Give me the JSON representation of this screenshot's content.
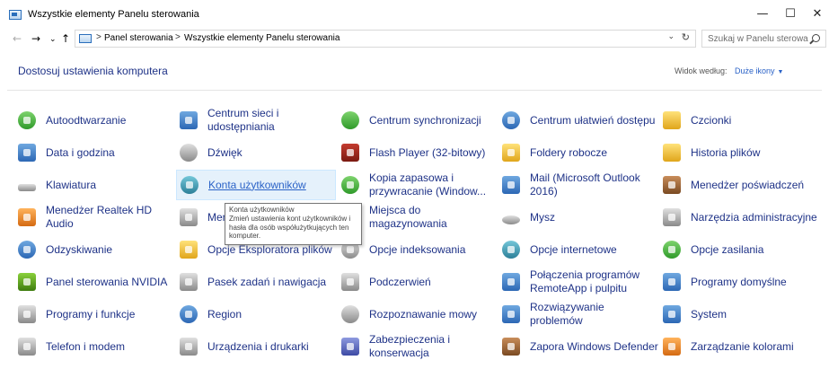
{
  "window": {
    "title": "Wszystkie elementy Panelu sterowania",
    "minimize": "—",
    "maximize": "☐",
    "close": "✕"
  },
  "nav": {
    "back": "←",
    "forward": "→",
    "recent": "⌄",
    "up": "↑"
  },
  "address": {
    "crumbs": [
      "Panel sterowania",
      "Wszystkie elementy Panelu sterowania"
    ],
    "separator": ">",
    "dropdown": "⌄",
    "refresh": "↻"
  },
  "search": {
    "placeholder": "Szukaj w Panelu sterowania"
  },
  "header": {
    "title": "Dostosuj ustawienia komputera",
    "view_label": "Widok według:",
    "view_value": "Duże ikony",
    "view_dropdown": "▼"
  },
  "items": [
    {
      "label": "Autoodtwarzanie",
      "icon": "autoplay-icon"
    },
    {
      "label": "Centrum sieci i udostępniania",
      "icon": "network-center-icon"
    },
    {
      "label": "Centrum synchronizacji",
      "icon": "sync-center-icon"
    },
    {
      "label": "Centrum ułatwień dostępu",
      "icon": "ease-of-access-icon"
    },
    {
      "label": "Czcionki",
      "icon": "fonts-icon"
    },
    {
      "label": "Data i godzina",
      "icon": "date-time-icon"
    },
    {
      "label": "Dźwięk",
      "icon": "sound-icon"
    },
    {
      "label": "Flash Player (32-bitowy)",
      "icon": "flash-player-icon"
    },
    {
      "label": "Foldery robocze",
      "icon": "work-folders-icon"
    },
    {
      "label": "Historia plików",
      "icon": "file-history-icon"
    },
    {
      "label": "Klawiatura",
      "icon": "keyboard-icon"
    },
    {
      "label": "Konta użytkowników",
      "icon": "user-accounts-icon"
    },
    {
      "label": "Kopia zapasowa i przywracanie (Window...",
      "icon": "backup-restore-icon"
    },
    {
      "label": "Mail (Microsoft Outlook 2016)",
      "icon": "mail-icon"
    },
    {
      "label": "Menedżer poświadczeń",
      "icon": "credential-manager-icon"
    },
    {
      "label": "Menedżer Realtek HD Audio",
      "icon": "realtek-audio-icon"
    },
    {
      "label": "Menedżer urządzeń",
      "icon": "device-manager-icon"
    },
    {
      "label": "Miejsca do magazynowania",
      "icon": "storage-spaces-icon"
    },
    {
      "label": "Mysz",
      "icon": "mouse-icon"
    },
    {
      "label": "Narzędzia administracyjne",
      "icon": "admin-tools-icon"
    },
    {
      "label": "Odzyskiwanie",
      "icon": "recovery-icon"
    },
    {
      "label": "Opcje Eksploratora plików",
      "icon": "explorer-options-icon"
    },
    {
      "label": "Opcje indeksowania",
      "icon": "indexing-options-icon"
    },
    {
      "label": "Opcje internetowe",
      "icon": "internet-options-icon"
    },
    {
      "label": "Opcje zasilania",
      "icon": "power-options-icon"
    },
    {
      "label": "Panel sterowania NVIDIA",
      "icon": "nvidia-icon"
    },
    {
      "label": "Pasek zadań i nawigacja",
      "icon": "taskbar-icon"
    },
    {
      "label": "Podczerwień",
      "icon": "infrared-icon"
    },
    {
      "label": "Połączenia programów RemoteApp i pulpitu",
      "icon": "remoteapp-icon"
    },
    {
      "label": "Programy domyślne",
      "icon": "default-programs-icon"
    },
    {
      "label": "Programy i funkcje",
      "icon": "programs-features-icon"
    },
    {
      "label": "Region",
      "icon": "region-icon"
    },
    {
      "label": "Rozpoznawanie mowy",
      "icon": "speech-recognition-icon"
    },
    {
      "label": "Rozwiązywanie problemów",
      "icon": "troubleshooting-icon"
    },
    {
      "label": "System",
      "icon": "system-icon"
    },
    {
      "label": "Telefon i modem",
      "icon": "phone-modem-icon"
    },
    {
      "label": "Urządzenia i drukarki",
      "icon": "devices-printers-icon"
    },
    {
      "label": "Zabezpieczenia i konserwacja",
      "icon": "security-maintenance-icon"
    },
    {
      "label": "Zapora Windows Defender",
      "icon": "firewall-icon"
    },
    {
      "label": "Zarządzanie kolorami",
      "icon": "color-management-icon"
    }
  ],
  "tooltip": {
    "title": "Konta użytkowników",
    "body": "Zmień ustawienia kont użytkowników i hasła dla osób współużytkujących ten komputer."
  }
}
